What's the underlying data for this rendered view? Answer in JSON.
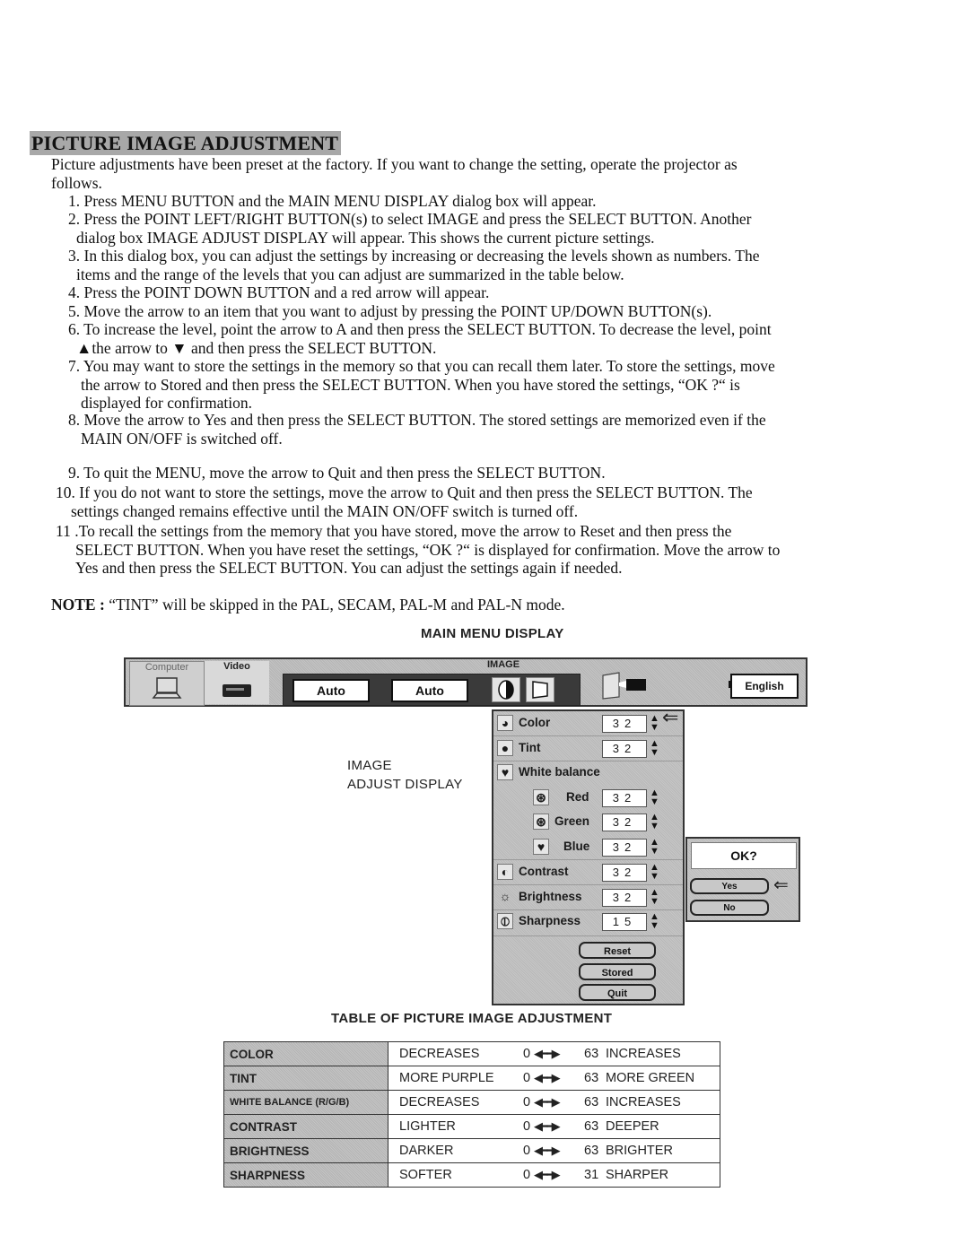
{
  "title": "PICTURE IMAGE ADJUSTMENT",
  "intro": [
    "Picture adjustments have been preset at the factory. If you want to change the setting, operate the projector as",
    "follows."
  ],
  "steps": [
    {
      "lines": [
        "1.  Press MENU BUTTON and the MAIN MENU DISPLAY dialog box will appear."
      ]
    },
    {
      "lines": [
        "2.  Press the POINT LEFT/RIGHT BUTTON(s) to select IMAGE and press the SELECT BUTTON. Another",
        "dialog box IMAGE ADJUST DISPLAY will appear. This shows the current picture settings."
      ]
    },
    {
      "lines": [
        "3.  In this dialog box, you can adjust the settings by increasing or decreasing the levels shown as numbers. The",
        "items and the range of the levels that you can adjust are summarized in the table below."
      ]
    },
    {
      "lines": [
        "4.  Press the POINT DOWN BUTTON and a red arrow will appear."
      ]
    },
    {
      "lines": [
        "5.  Move the arrow to an item that you want to adjust by pressing the POINT UP/DOWN BUTTON(s)."
      ]
    },
    {
      "lines": [
        "6.  To increase the level, point the arrow to A and then press the SELECT BUTTON. To decrease the level, point",
        "▲the arrow to ▼ and then press the SELECT BUTTON."
      ]
    },
    {
      "lines": [
        "7. You may want to store the settings in the memory so that you can recall them later. To store the settings, move",
        "the arrow to Stored and then press the SELECT BUTTON. When you have stored the settings, “OK ?“ is",
        "displayed for confirmation."
      ]
    },
    {
      "lines": [
        "8. Move the arrow to Yes and then press the SELECT BUTTON. The stored settings are memorized even if the",
        "MAIN ON/OFF is switched off."
      ]
    },
    {
      "lines": [
        "9.  To quit the MENU, move the arrow to Quit and then press the SELECT BUTTON."
      ]
    },
    {
      "lines": [
        "10.  If you do not want to store the settings, move the arrow to Quit and then press the SELECT BUTTON. The",
        "settings changed remains effective until the MAIN ON/OFF switch is turned off."
      ]
    },
    {
      "lines": [
        "11 .To recall the settings from the memory that you have stored, move the arrow to Reset and then press the",
        "SELECT BUTTON. When you have reset the settings, “OK ?“ is displayed for confirmation. Move the arrow to",
        "Yes and then press the SELECT BUTTON. You can adjust the settings again if needed."
      ]
    }
  ],
  "note": {
    "label": "NOTE :",
    "text": " “TINT” will be skipped in the PAL, SECAM, PAL-M and PAL-N mode."
  },
  "figure": {
    "main_menu_caption": "MAIN MENU DISPLAY",
    "image_adjust_caption": [
      "IMAGE",
      "ADJUST DISPLAY"
    ],
    "menubar": {
      "tabs": [
        "Computer",
        "Video"
      ],
      "auto_1": "Auto",
      "auto_2": "Auto",
      "image_label": "IMAGE",
      "language": "English"
    },
    "adjust_items": [
      {
        "label": "Color",
        "value": "32",
        "icon": "color-icon"
      },
      {
        "label": "Tint",
        "value": "32",
        "icon": "tint-icon"
      },
      {
        "label": "White balance",
        "value": null,
        "icon": "white-balance-icon"
      },
      {
        "label": "Red",
        "value": "32",
        "icon": "red-icon"
      },
      {
        "label": "Green",
        "value": "32",
        "icon": "green-icon"
      },
      {
        "label": "Blue",
        "value": "32",
        "icon": "blue-icon"
      },
      {
        "label": "Contrast",
        "value": "32",
        "icon": "contrast-icon"
      },
      {
        "label": "Brightness",
        "value": "32",
        "icon": "brightness-icon"
      },
      {
        "label": "Sharpness",
        "value": "15",
        "icon": "sharpness-icon"
      }
    ],
    "panel_buttons": [
      "Reset",
      "Stored",
      "Quit"
    ],
    "ok_dialog": {
      "label": "OK?",
      "yes": "Yes",
      "no": "No"
    }
  },
  "table": {
    "caption": "TABLE OF PICTURE IMAGE ADJUSTMENT",
    "rows": [
      {
        "item": "COLOR",
        "low": "DECREASES",
        "min": "0",
        "max": "63",
        "high": "INCREASES"
      },
      {
        "item": "TINT",
        "low": "MORE PURPLE",
        "min": "0",
        "max": "63",
        "high": "MORE GREEN"
      },
      {
        "item": "WHITE BALANCE (R/G/B)",
        "low": "DECREASES",
        "min": "0",
        "max": "63",
        "high": "INCREASES"
      },
      {
        "item": "CONTRAST",
        "low": "LIGHTER",
        "min": "0",
        "max": "63",
        "high": "DEEPER"
      },
      {
        "item": "BRIGHTNESS",
        "low": "DARKER",
        "min": "0",
        "max": "63",
        "high": "BRIGHTER"
      },
      {
        "item": "SHARPNESS",
        "low": "SOFTER",
        "min": "0",
        "max": "31",
        "high": "SHARPER"
      }
    ]
  }
}
